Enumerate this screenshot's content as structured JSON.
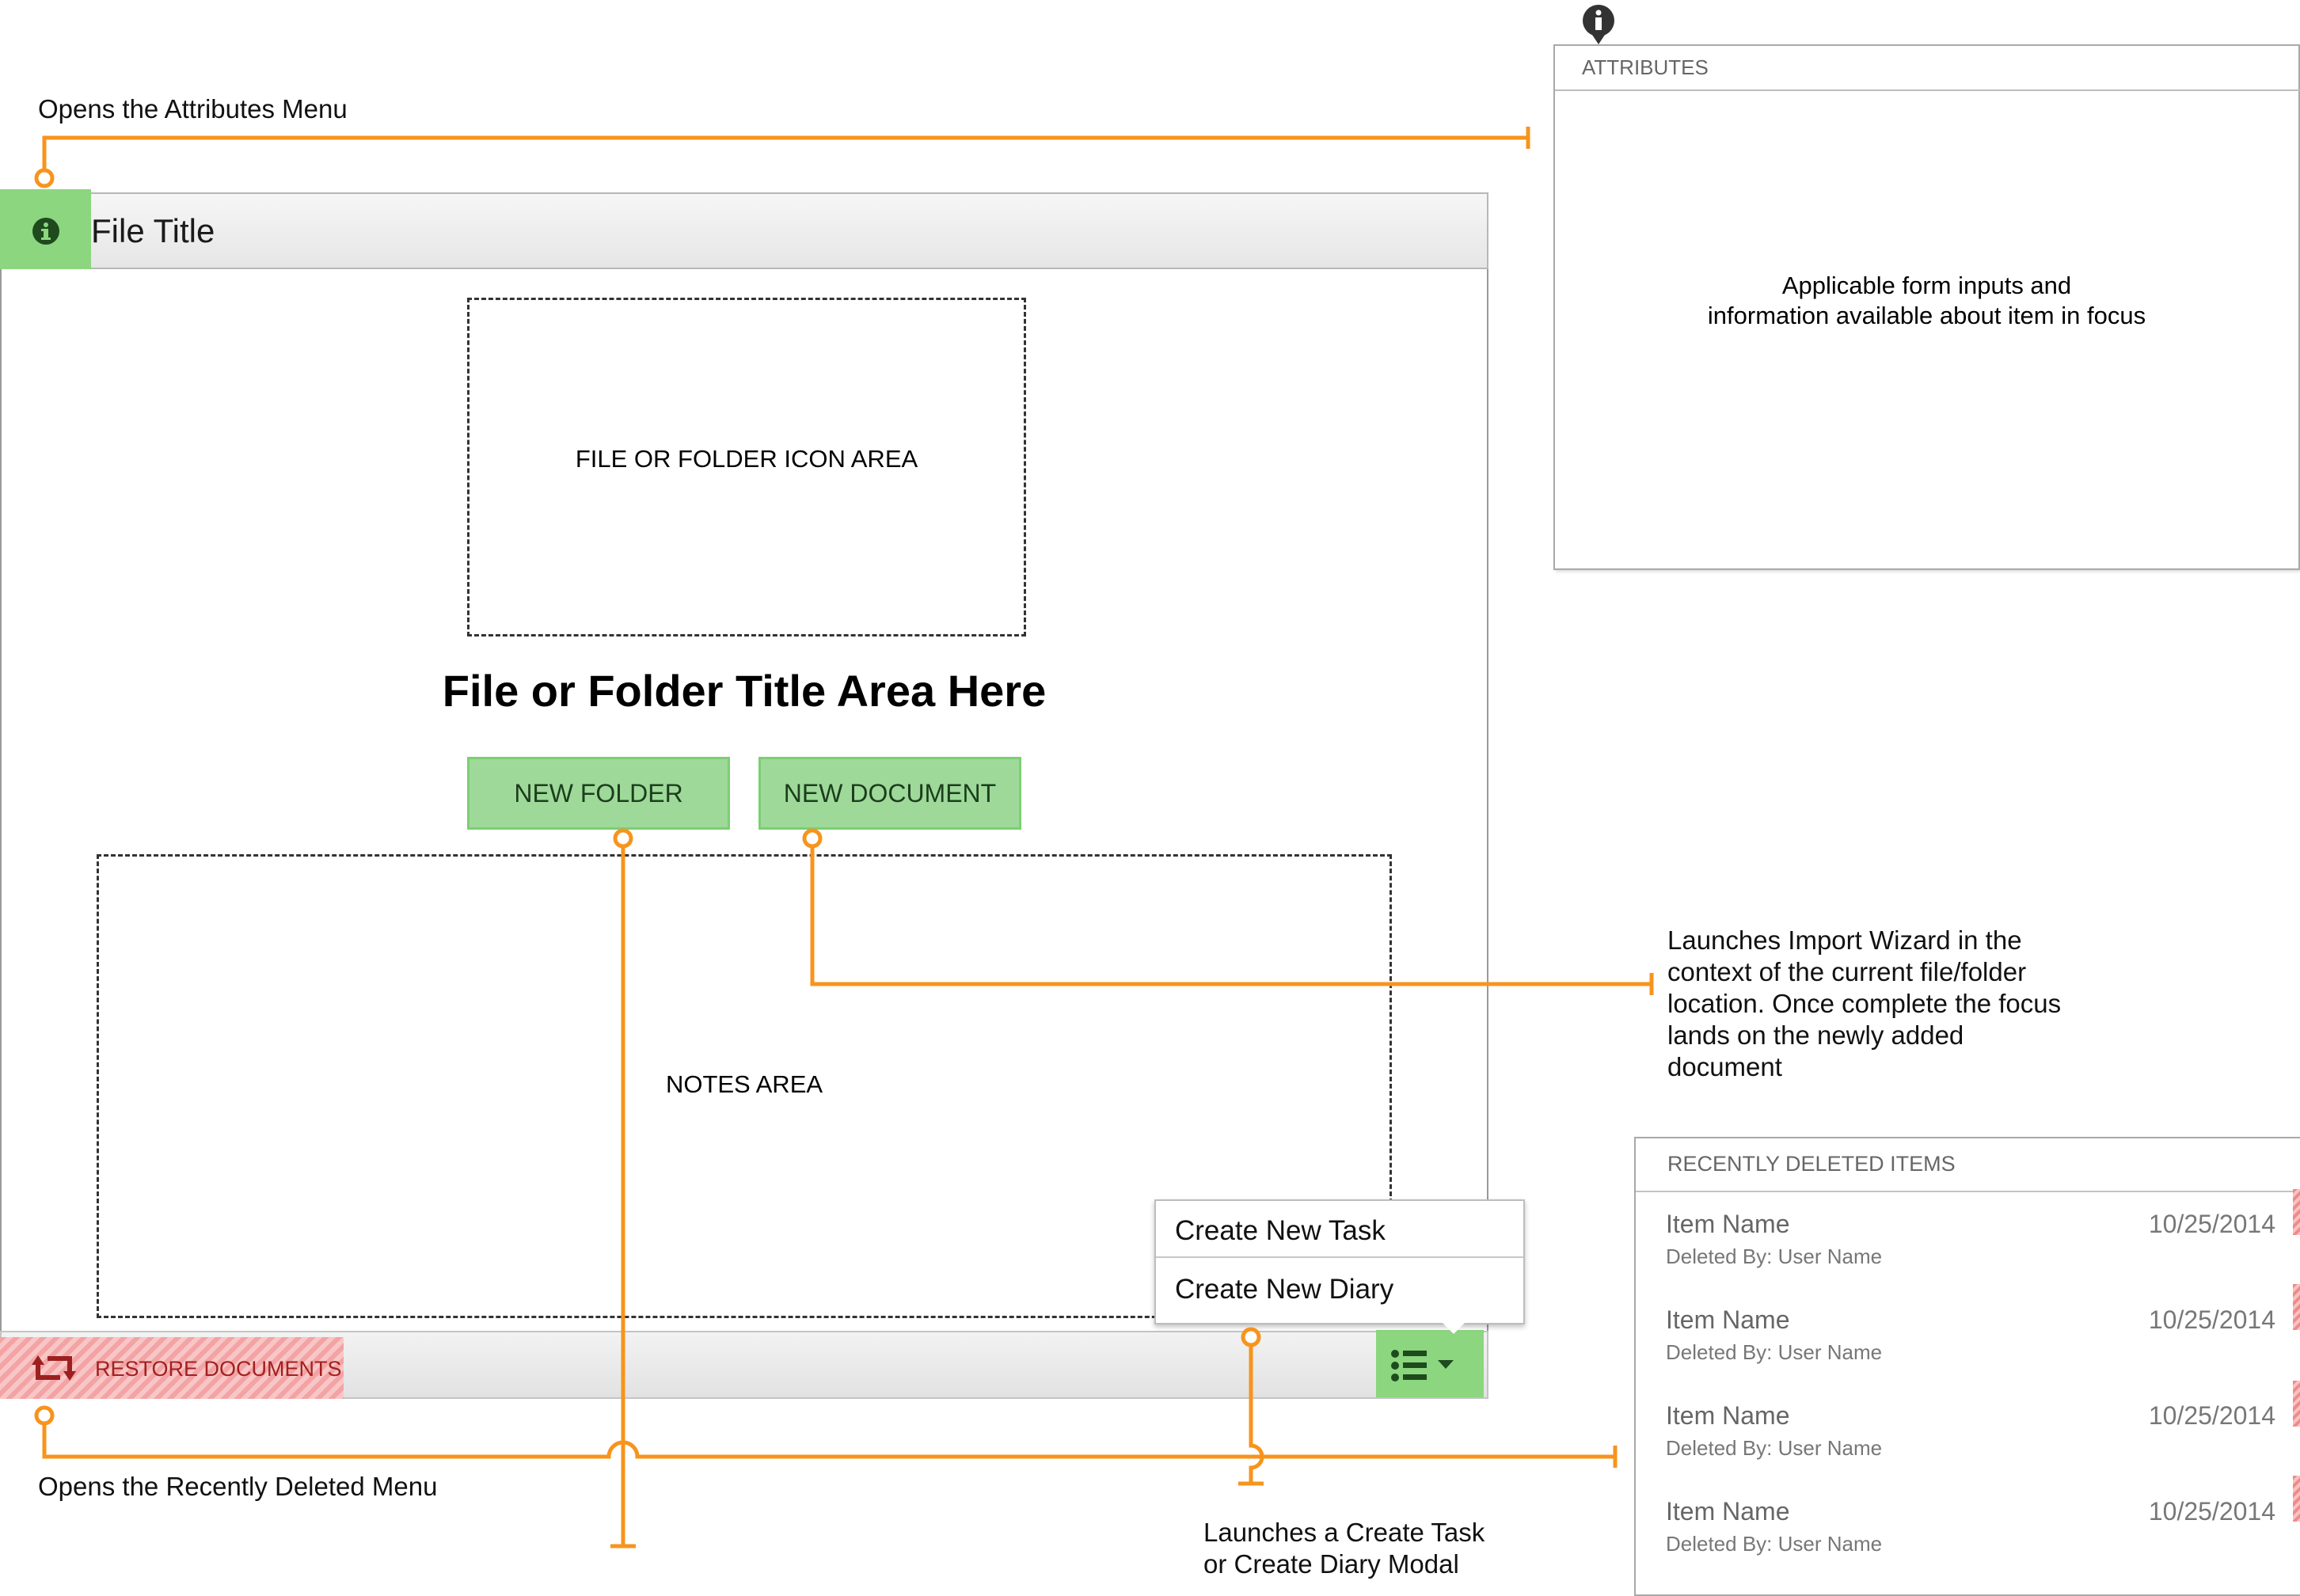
{
  "main": {
    "file_title": "File Title",
    "icon_area_label": "FILE OR FOLDER ICON AREA",
    "folder_title": "File or Folder Title Area Here",
    "new_folder_label": "NEW FOLDER",
    "new_document_label": "NEW DOCUMENT",
    "notes_area_label": "NOTES AREA",
    "restore_label": "RESTORE DOCUMENTS"
  },
  "menu": {
    "items": [
      "Create New Task",
      "Create New Diary"
    ]
  },
  "attributes_panel": {
    "header": "ATTRIBUTES",
    "body_line1": "Applicable form inputs and",
    "body_line2": "information available about item in focus"
  },
  "deleted_panel": {
    "header": "RECENTLY DELETED ITEMS",
    "items": [
      {
        "name": "Item Name",
        "date": "10/25/2014",
        "deleted_by": "Deleted By: User Name"
      },
      {
        "name": "Item Name",
        "date": "10/25/2014",
        "deleted_by": "Deleted By: User Name"
      },
      {
        "name": "Item Name",
        "date": "10/25/2014",
        "deleted_by": "Deleted By: User Name"
      },
      {
        "name": "Item Name",
        "date": "10/25/2014",
        "deleted_by": "Deleted By: User Name"
      }
    ]
  },
  "annotations": {
    "attributes_menu": "Opens the Attributes Menu",
    "recently_deleted": "Opens the Recently Deleted Menu",
    "import_wizard": [
      "Launches Import Wizard in the",
      "context of the current file/folder",
      "location. Once complete the focus",
      "lands on the newly added",
      "document"
    ],
    "create_task": [
      "Launches a Create Task",
      "or Create Diary Modal"
    ]
  },
  "colors": {
    "connector": "#f7941d",
    "accent_green": "#8bd67e",
    "restore_red": "#f3a3a3"
  },
  "icons": {
    "info": "info-circle-icon",
    "restore": "retweet-icon",
    "list": "list-icon",
    "caret": "caret-down-icon"
  }
}
